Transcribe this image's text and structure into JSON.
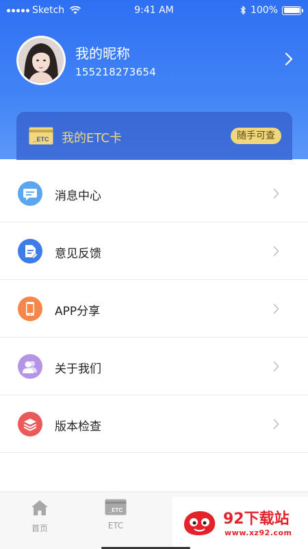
{
  "status_bar": {
    "carrier": "Sketch",
    "time": "9:41 AM",
    "battery": "100%"
  },
  "profile": {
    "nickname": "我的昵称",
    "phone": "155218273654"
  },
  "etc_card": {
    "icon_text": "_ETC",
    "title": "我的ETC卡",
    "badge": "随手可查"
  },
  "menu": [
    {
      "label": "消息中心",
      "icon": "message-icon",
      "color": "#5aa6ef"
    },
    {
      "label": "意见反馈",
      "icon": "feedback-document-icon",
      "color": "#3c7de8"
    },
    {
      "label": "APP分享",
      "icon": "phone-share-icon",
      "color": "#f5874a"
    },
    {
      "label": "关于我们",
      "icon": "users-icon",
      "color": "#b494e4"
    },
    {
      "label": "版本检查",
      "icon": "layers-icon",
      "color": "#ea5a5a"
    }
  ],
  "tabbar": {
    "home_label": "首页",
    "etc_label": "ETC",
    "etc_icon_text": "_ETC"
  },
  "watermark": {
    "name": "92下载站",
    "url": "www.xz92.com"
  },
  "colors": {
    "header_blue": "#2f6ff3",
    "accent_gold": "#f1d77c",
    "watermark_red": "#e3232b"
  }
}
